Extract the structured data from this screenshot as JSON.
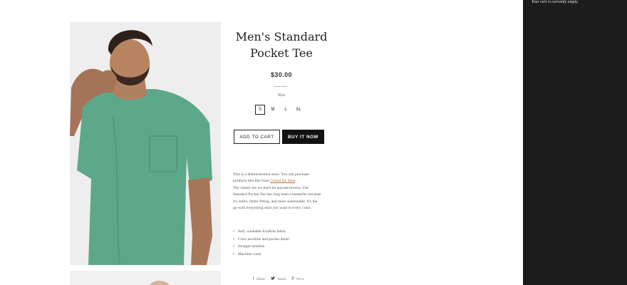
{
  "product": {
    "title_line1": "Men's Standard",
    "title_line2": "Pocket Tee",
    "price": "$30.00",
    "size_label": "Size",
    "sizes": [
      "S",
      "M",
      "L",
      "XL"
    ],
    "selected_size": "S",
    "add_to_cart_label": "ADD TO CART",
    "buy_now_label": "BUY IT NOW",
    "shirt_color": "#5ea88a"
  },
  "description": {
    "line1": "This is a demonstration store. You can purchase",
    "line2_prefix": "products like this from ",
    "line2_link": "United By Blue",
    "line2_suffix": ".",
    "line3": "The classic tee we don't let anyone borrow. Our",
    "line4": "Standard Pocket Tee has long been a bestseller because",
    "line5": "it's softer, better fitting, and more sustainable. It's the",
    "line6": "go-with everything shirt you want in every color."
  },
  "features": [
    "Soft, washable EcoKnit fabric",
    "Crew neckline and pocket detail",
    "Straight hemline",
    "Machine wash"
  ],
  "share": {
    "share_label": "Share",
    "tweet_label": "Tweet",
    "pin_label": "Pin it",
    "share_icon": "facebook-icon",
    "tweet_icon": "twitter-icon",
    "pin_icon": "pinterest-icon"
  },
  "cart": {
    "empty_message": "Your cart is currently empty."
  }
}
